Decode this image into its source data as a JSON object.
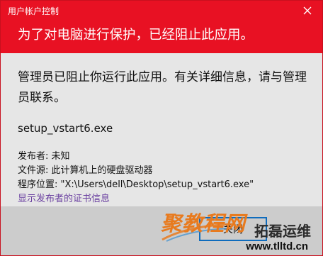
{
  "window": {
    "caption": "用户帐户控制",
    "headline": "为了对电脑进行保护，已经阻止此应用。"
  },
  "body": {
    "message": "管理员已阻止你运行此应用。有关详细信息，请与管理员联系。",
    "filename": "setup_vstart6.exe",
    "publisher": "发布者: 未知",
    "file_origin": "文件源: 此计算机上的硬盘驱动器",
    "program_location": "程序位置: \"X:\\Users\\dell\\Desktop\\setup_vstart6.exe\"",
    "cert_link": "显示发布者的证书信息"
  },
  "footer": {
    "close_label": "关闭"
  },
  "watermark": {
    "site_name": "聚教程网",
    "brand": "拓磊运维",
    "url": "www.tlltd.cn"
  },
  "colors": {
    "banner": "#e81123",
    "link": "#6a3fa0",
    "button_border": "#0f6cbd"
  }
}
